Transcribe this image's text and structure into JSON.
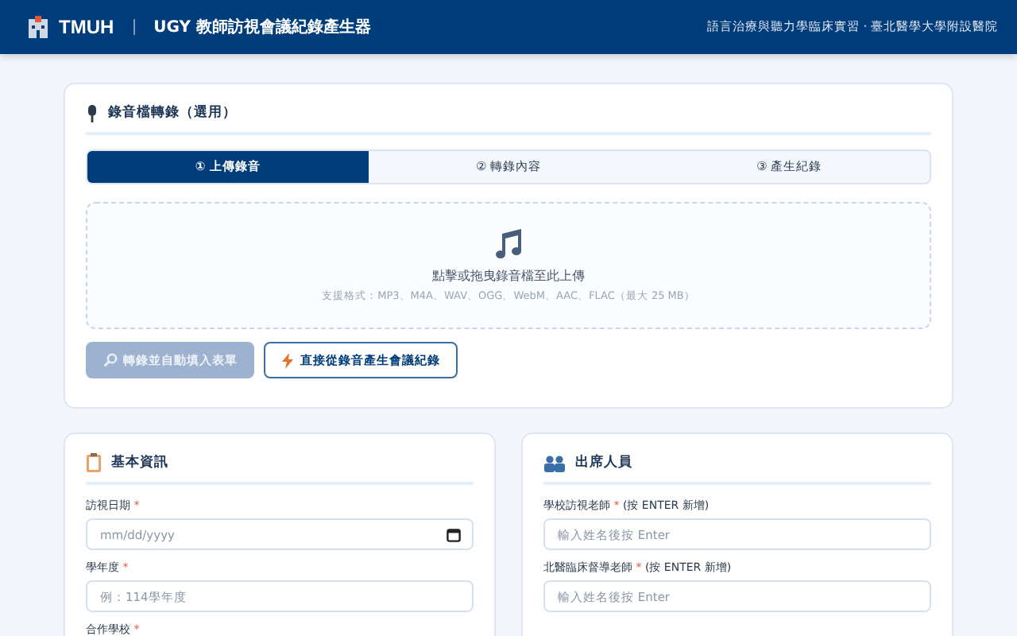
{
  "header": {
    "logo": "TMUH",
    "title": "UGY 教師訪視會議紀錄產生器",
    "subtitle": "語言治療與聽力學臨床實習 · 臺北醫學大學附設醫院"
  },
  "transcription": {
    "title": "錄音檔轉錄（選用）",
    "steps": [
      {
        "label": "① 上傳錄音",
        "selected": true
      },
      {
        "label": "② 轉錄內容",
        "selected": false
      },
      {
        "label": "③ 產生紀錄",
        "selected": false
      }
    ],
    "dropzone": {
      "prompt": "點擊或拖曳錄音檔至此上傳",
      "formats": "支援格式：MP3、M4A、WAV、OGG、WebM、AAC、FLAC（最大 25 MB）"
    },
    "buttons": [
      {
        "label": "轉錄並自動填入表單",
        "kind": "primary",
        "disabled": true
      },
      {
        "label": "直接從錄音產生會議紀錄",
        "kind": "outline",
        "disabled": false
      }
    ]
  },
  "basic_info": {
    "title": "基本資訊",
    "fields": [
      {
        "label": "訪視日期",
        "required_mark": "*",
        "kind": "date",
        "placeholder": "mm/dd/yyyy"
      },
      {
        "label": "學年度",
        "required_mark": "*",
        "kind": "text",
        "placeholder": "例：114學年度"
      },
      {
        "label": "合作學校",
        "required_mark": "*",
        "kind": "label"
      }
    ]
  },
  "attendees": {
    "title": "出席人員",
    "fields": [
      {
        "label": "學校訪視老師",
        "required_mark": "*",
        "hint": "(按 ENTER 新增)",
        "placeholder": "輸入姓名後按 Enter"
      },
      {
        "label": "北醫臨床督導老師",
        "required_mark": "*",
        "hint": "(按 ENTER 新增)",
        "placeholder": "輸入姓名後按 Enter"
      }
    ]
  }
}
